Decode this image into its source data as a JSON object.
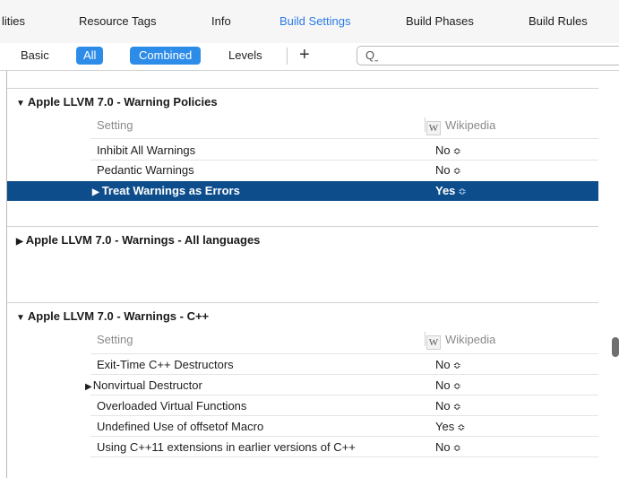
{
  "tabs": [
    {
      "label": "lities",
      "active": false
    },
    {
      "label": "Resource Tags",
      "active": false
    },
    {
      "label": "Info",
      "active": false
    },
    {
      "label": "Build Settings",
      "active": true
    },
    {
      "label": "Build Phases",
      "active": false
    },
    {
      "label": "Build Rules",
      "active": false
    }
  ],
  "filter": {
    "basic": "Basic",
    "all": "All",
    "combined": "Combined",
    "levels": "Levels",
    "add": "+",
    "search_icon": "search-icon",
    "search_value": ""
  },
  "columns": {
    "setting": "Setting",
    "wiki_icon": "W",
    "wikipedia": "Wikipedia"
  },
  "sections": [
    {
      "title": "Apple LLVM 7.0 - Warning Policies",
      "expanded": true,
      "rows": [
        {
          "label": "Inhibit All Warnings",
          "value": "No"
        },
        {
          "label": "Pedantic Warnings",
          "value": "No"
        },
        {
          "label": "Treat Warnings as Errors",
          "value": "Yes",
          "selected": true
        }
      ]
    },
    {
      "title": "Apple LLVM 7.0 - Warnings - All languages",
      "expanded": false,
      "rows": []
    },
    {
      "title": "Apple LLVM 7.0 - Warnings - C++",
      "expanded": true,
      "rows": [
        {
          "label": "Exit-Time C++ Destructors",
          "value": "No"
        },
        {
          "label": "Nonvirtual Destructor",
          "value": "No"
        },
        {
          "label": "Overloaded Virtual Functions",
          "value": "No"
        },
        {
          "label": "Undefined Use of offsetof Macro",
          "value": "Yes"
        },
        {
          "label": "Using C++11 extensions in earlier versions of C++",
          "value": "No"
        }
      ]
    }
  ],
  "glyphs": {
    "expanded": "▼",
    "collapsed": "▶",
    "stepper": "≎"
  },
  "colors": {
    "accent": "#2d8ce8",
    "selection": "#0d4d8c",
    "active_tab": "#2c7be5"
  }
}
